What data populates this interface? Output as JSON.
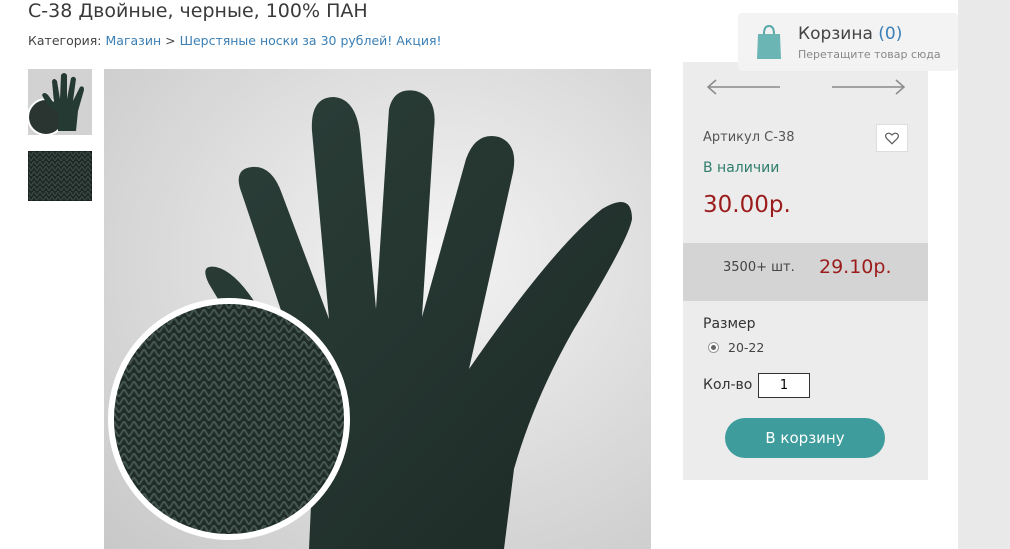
{
  "product": {
    "title": "С-38 Двойные, черные, 100% ПАН",
    "breadcrumb": {
      "label": "Категория:",
      "items": [
        "Магазин",
        "Шерстяные носки за 30 рублей! Акция!"
      ],
      "separator": ">"
    },
    "sku": "Артикул С-38",
    "stock": "В наличии",
    "price": "30.00р.",
    "bulk": {
      "qty": "3500+ шт.",
      "price": "29.10р."
    },
    "size": {
      "label": "Размер",
      "options": [
        "20-22"
      ],
      "selected": "20-22"
    },
    "quantity": {
      "label": "Кол-во",
      "value": "1"
    },
    "add_to_cart": "В корзину"
  },
  "cart": {
    "title": "Корзина",
    "count": "(0)",
    "hint": "Перетащите товар сюда"
  },
  "icons": {
    "bag": "shopping-bag-icon",
    "favorite": "heart-icon",
    "prev": "arrow-left-icon",
    "next": "arrow-right-icon"
  },
  "colors": {
    "accent_button": "#3f9c9c",
    "price": "#9b1c1c",
    "link": "#3b7fb5",
    "stock": "#2f7d6b",
    "panel_bg": "#ececec",
    "bulk_bg": "#d4d4d4"
  }
}
